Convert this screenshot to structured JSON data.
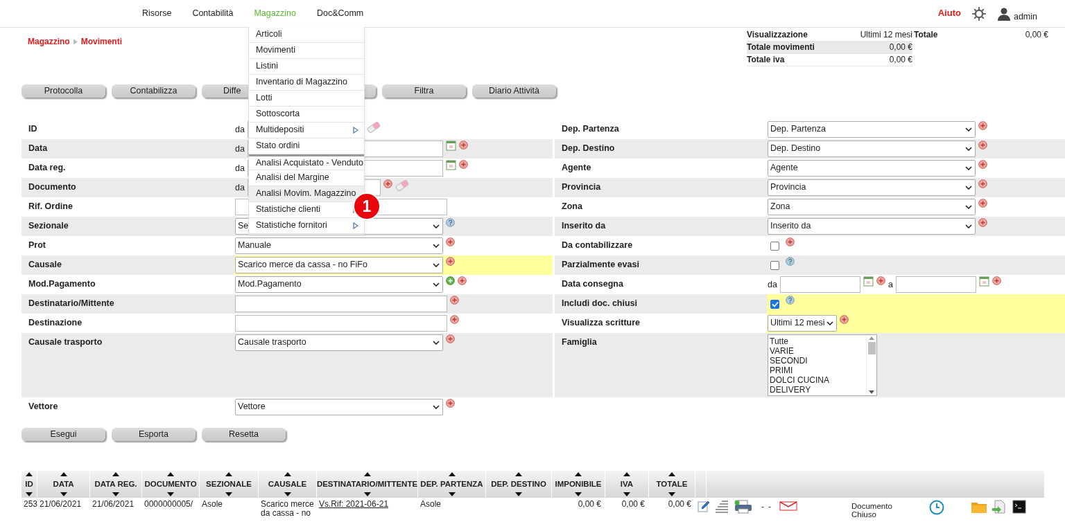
{
  "nav": {
    "items": [
      {
        "label": "Risorse",
        "selected": false
      },
      {
        "label": "Contabilità",
        "selected": false
      },
      {
        "label": "Magazzino",
        "selected": true
      },
      {
        "label": "Doc&Comm",
        "selected": false
      }
    ],
    "help": "Aiuto",
    "user": "admin"
  },
  "breadcrumb": [
    "Magazzino",
    "Movimenti"
  ],
  "summary": [
    {
      "label": "Visualizzazione",
      "value": "Ultimi 12 mesi",
      "extra_label": "Totale",
      "extra_value": "0,00 €"
    },
    {
      "label": "Totale movimenti",
      "value": "0,00 €"
    },
    {
      "label": "Totale iva",
      "value": "0,00 €"
    }
  ],
  "toolbar": [
    {
      "kind": "button",
      "label": "Protocolla"
    },
    {
      "kind": "button",
      "label": "Contabilizza"
    },
    {
      "kind": "button",
      "label": "Diffe"
    },
    {
      "kind": "covered"
    },
    {
      "kind": "button",
      "label": "Filtra"
    },
    {
      "kind": "button",
      "label": "Diario Attività"
    }
  ],
  "left_fields": [
    {
      "label": "ID",
      "kind": "range",
      "prefix": "da",
      "clear": true,
      "highlighted": false
    },
    {
      "label": "Data",
      "kind": "range",
      "prefix": "da",
      "date_picker": true,
      "remove": true,
      "highlighted": false
    },
    {
      "label": "Data reg.",
      "kind": "range",
      "prefix": "da",
      "date_picker": true,
      "remove": true,
      "highlighted": false
    },
    {
      "label": "Documento",
      "kind": "range",
      "prefix": "da",
      "remove": true,
      "clear": true,
      "highlighted": false
    },
    {
      "label": "Rif. Ordine",
      "kind": "text",
      "highlighted": false
    },
    {
      "label": "Sezionale",
      "kind": "select",
      "value": "Se",
      "help": true,
      "highlighted": false
    },
    {
      "label": "Prot",
      "kind": "select",
      "value": "Manuale",
      "remove": true,
      "highlighted": false
    },
    {
      "label": "Causale",
      "kind": "select",
      "value": "Scarico merce da cassa - no FiFo",
      "remove": true,
      "highlighted": true
    },
    {
      "label": "Mod.Pagamento",
      "kind": "select",
      "value": "Mod.Pagamento",
      "add": true,
      "remove": true,
      "highlighted": false
    },
    {
      "label": "Destinatario/Mittente",
      "kind": "text",
      "remove": true,
      "highlighted": false
    },
    {
      "label": "Destinazione",
      "kind": "text",
      "remove": true,
      "highlighted": false
    },
    {
      "label": "Causale trasporto",
      "kind": "select",
      "value": "Causale trasporto",
      "remove": true,
      "highlighted": false
    },
    {
      "label": "Vettore",
      "kind": "select",
      "value": "Vettore",
      "remove": true,
      "highlighted": false
    }
  ],
  "right_fields": [
    {
      "label": "Dep. Partenza",
      "kind": "select",
      "value": "Dep. Partenza",
      "remove": true,
      "highlighted": false
    },
    {
      "label": "Dep. Destino",
      "kind": "select",
      "value": "Dep. Destino",
      "remove": true,
      "highlighted": false
    },
    {
      "label": "Agente",
      "kind": "select",
      "value": "Agente",
      "remove": true,
      "highlighted": false
    },
    {
      "label": "Provincia",
      "kind": "select",
      "value": "Provincia",
      "remove": true,
      "highlighted": false
    },
    {
      "label": "Zona",
      "kind": "select",
      "value": "Zona",
      "remove": true,
      "highlighted": false
    },
    {
      "label": "Inserito da",
      "kind": "select",
      "value": "Inserito da",
      "remove": true,
      "highlighted": false
    },
    {
      "label": "Da contabilizzare",
      "kind": "checkbox",
      "checked": false,
      "remove": true,
      "highlighted": false
    },
    {
      "label": "Parzialmente evasi",
      "kind": "checkbox",
      "checked": false,
      "help": true,
      "highlighted": false
    },
    {
      "label": "Data consegna",
      "kind": "daterange",
      "prefix": "da",
      "separator": "a",
      "date_picker": true,
      "remove": true,
      "highlighted": false
    },
    {
      "label": "Includi doc. chiusi",
      "kind": "checkbox",
      "checked": true,
      "help": true,
      "highlighted": true
    },
    {
      "label": "Visualizza scritture",
      "kind": "smallselect",
      "value": "Ultimi 12 mesi",
      "remove": true,
      "highlighted": true
    },
    {
      "label": "Famiglia",
      "kind": "listbox",
      "options": [
        "Tutte",
        "VARIE",
        "SECONDI",
        "PRIMI",
        "DOLCI CUCINA",
        "DELIVERY"
      ],
      "highlighted": false
    }
  ],
  "actions": [
    "Esegui",
    "Esporta",
    "Resetta"
  ],
  "menu": [
    {
      "label": "Articoli",
      "selected": false,
      "submenu": false,
      "separator_before": false
    },
    {
      "label": "Movimenti",
      "selected": false,
      "submenu": false,
      "separator_before": false
    },
    {
      "label": "Listini",
      "selected": false,
      "submenu": false,
      "separator_before": false
    },
    {
      "label": "Inventario di Magazzino",
      "selected": false,
      "submenu": false,
      "separator_before": false
    },
    {
      "label": "Lotti",
      "selected": false,
      "submenu": false,
      "separator_before": false
    },
    {
      "label": "Sottoscorta",
      "selected": false,
      "submenu": false,
      "separator_before": false
    },
    {
      "label": "Multidepositi",
      "selected": false,
      "submenu": true,
      "separator_before": false
    },
    {
      "label": "Stato ordini",
      "selected": false,
      "submenu": false,
      "separator_before": false
    },
    {
      "label": "Analisi Acquistato - Venduto",
      "selected": false,
      "submenu": false,
      "separator_before": true
    },
    {
      "label": "Analisi del Margine",
      "selected": false,
      "submenu": false,
      "separator_before": false
    },
    {
      "label": "Analisi Movim. Magazzino",
      "selected": true,
      "submenu": false,
      "separator_before": false
    },
    {
      "label": "Statistiche clienti",
      "selected": false,
      "submenu": true,
      "separator_before": false
    },
    {
      "label": "Statistiche fornitori",
      "selected": false,
      "submenu": true,
      "separator_before": false
    }
  ],
  "callout": "1",
  "table": {
    "columns": [
      {
        "label": "ID",
        "kind": "text"
      },
      {
        "label": "DATA",
        "kind": "text"
      },
      {
        "label": "DATA REG.",
        "kind": "text"
      },
      {
        "label": "DOCUMENTO",
        "kind": "text"
      },
      {
        "label": "SEZIONALE",
        "kind": "text"
      },
      {
        "label": "CAUSALE",
        "kind": "text"
      },
      {
        "label": "DESTINATARIO/MITTENTE",
        "kind": "text"
      },
      {
        "label": "DEP. PARTENZA",
        "kind": "text"
      },
      {
        "label": "DEP. DESTINO",
        "kind": "text"
      },
      {
        "label": "IMPONIBILE",
        "kind": "amount"
      },
      {
        "label": "IVA",
        "kind": "amount"
      },
      {
        "label": "TOTALE",
        "kind": "amount"
      }
    ],
    "rows": [
      {
        "cells": [
          {
            "text": "253"
          },
          {
            "text": "21/06/2021"
          },
          {
            "text": "21/06/2021"
          },
          {
            "text": "0000000005/"
          },
          {
            "text": "Asole"
          },
          {
            "text": "Scarico merce da cassa - no"
          },
          {
            "text": "Vs.Rif: 2021-06-21",
            "kind": "link"
          },
          {
            "text": "Asole"
          },
          {},
          {
            "text": "0,00 €"
          },
          {
            "text": "0,00 €"
          },
          {
            "text": "0,00 €"
          }
        ],
        "marks": [
          "-",
          "-"
        ],
        "status": "Documento Chiuso"
      }
    ]
  }
}
